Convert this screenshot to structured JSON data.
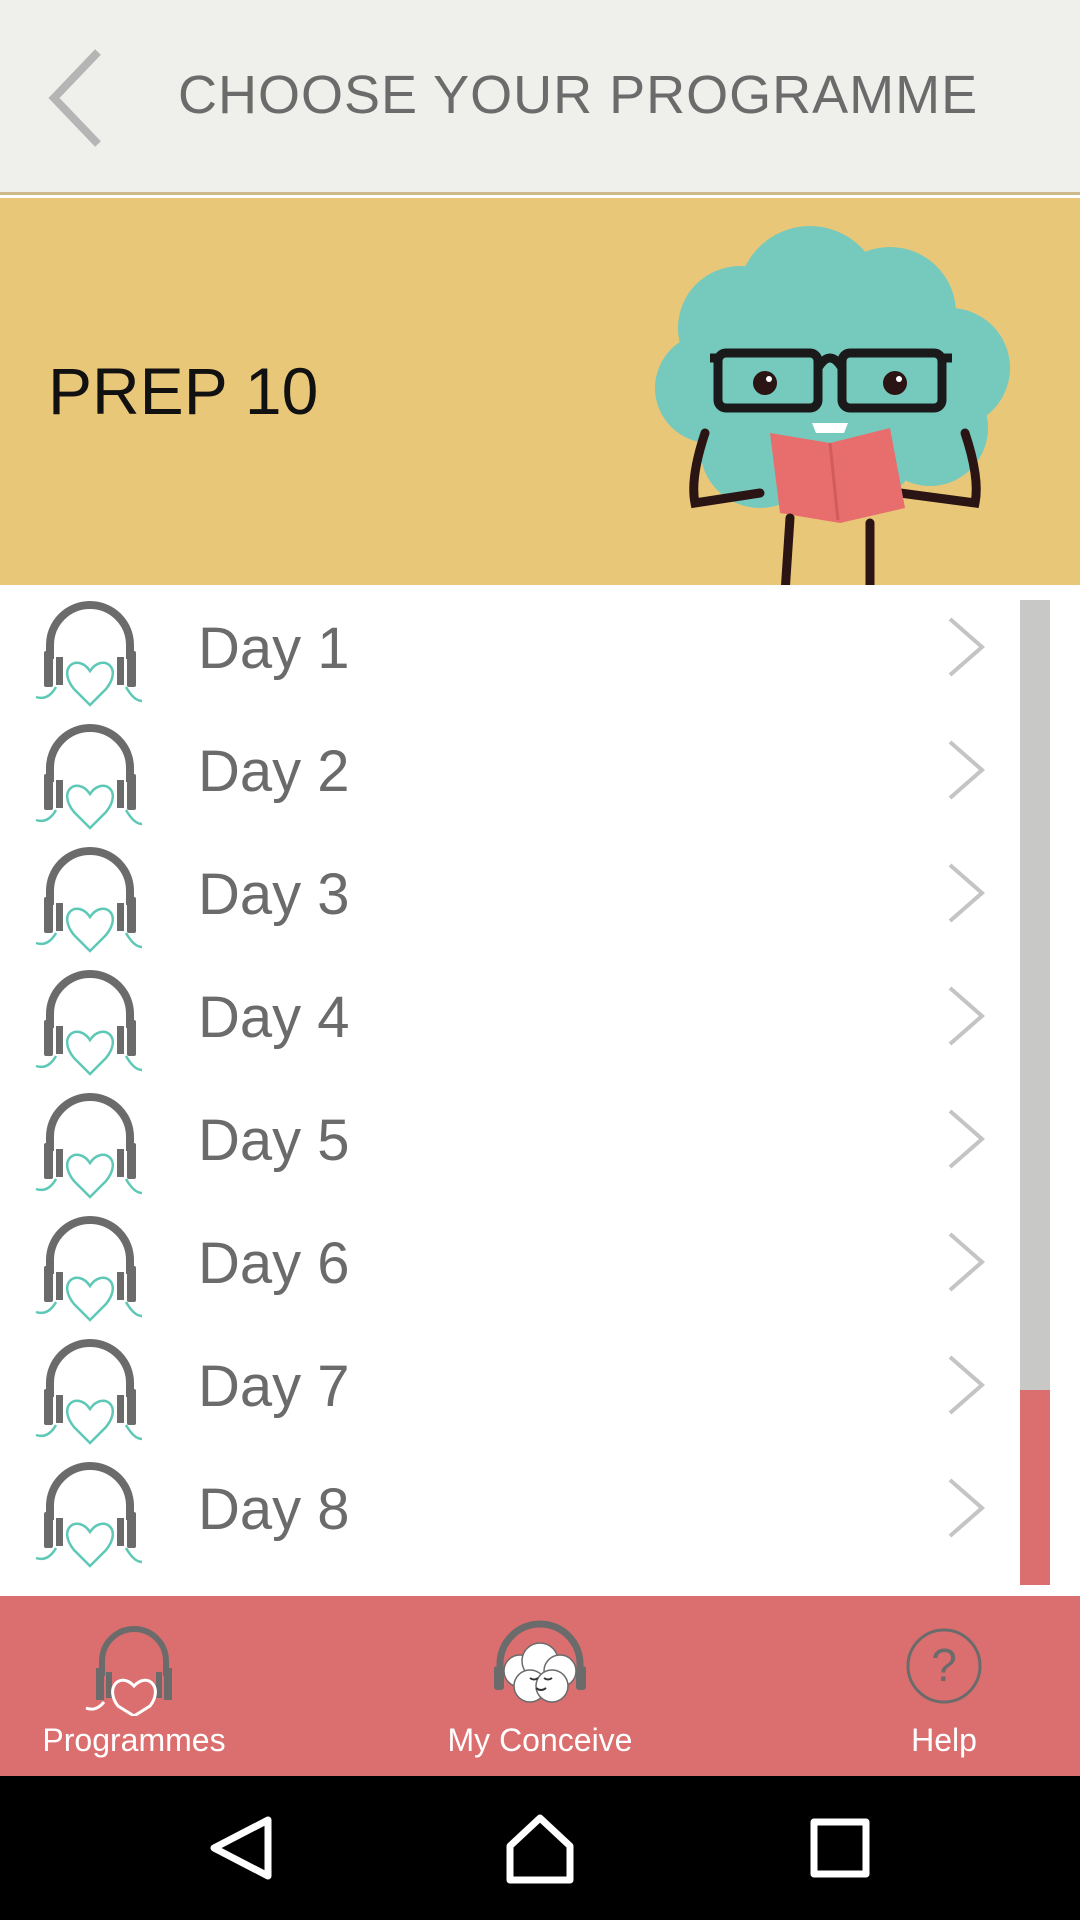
{
  "header": {
    "title": "CHOOSE YOUR PROGRAMME"
  },
  "banner": {
    "title": "PREP 10"
  },
  "list": {
    "items": [
      {
        "label": "Day 1"
      },
      {
        "label": "Day 2"
      },
      {
        "label": "Day 3"
      },
      {
        "label": "Day 4"
      },
      {
        "label": "Day 5"
      },
      {
        "label": "Day 6"
      },
      {
        "label": "Day 7"
      },
      {
        "label": "Day 8"
      }
    ]
  },
  "bottom_nav": {
    "items": [
      {
        "label": "Programmes",
        "icon": "headphones-heart-icon"
      },
      {
        "label": "My Conceive",
        "icon": "brain-headphones-icon"
      },
      {
        "label": "Help",
        "icon": "help-circle-icon"
      }
    ]
  },
  "colors": {
    "header_bg": "#efefeb",
    "banner_bg": "#e9c779",
    "accent": "#db6f6f",
    "teal": "#5ec8b7",
    "text_gray": "#6b6b6b"
  },
  "system_nav": {
    "buttons": [
      "back-icon",
      "home-icon",
      "recents-icon"
    ]
  }
}
